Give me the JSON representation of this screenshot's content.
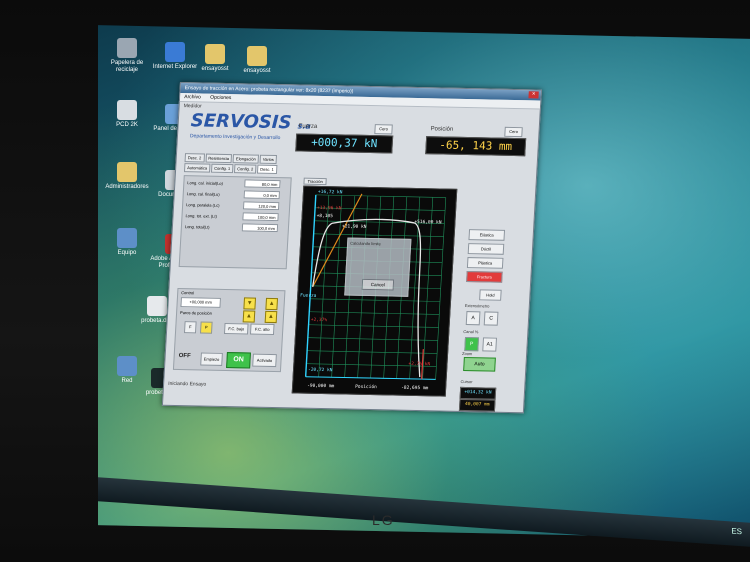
{
  "desktop": {
    "icons": [
      {
        "label": "Papelera de reciclaje",
        "icon": "recycle-bin-icon",
        "color": "#9aa6b2"
      },
      {
        "label": "Internet Explorer",
        "icon": "ie-icon",
        "color": "#3a7bd5"
      },
      {
        "label": "ensayosst",
        "icon": "folder-icon",
        "color": "#e3c66b"
      },
      {
        "label": "ensayosst",
        "icon": "folder-icon",
        "color": "#e3c66b"
      },
      {
        "label": "PCD 2K",
        "icon": "app-icon",
        "color": "#d8dde2"
      },
      {
        "label": "Panel de control",
        "icon": "control-panel-icon",
        "color": "#6aa0d8"
      },
      {
        "label": "Administradores",
        "icon": "folder-icon",
        "color": "#e3c66b"
      },
      {
        "label": "Documentos",
        "icon": "documents-icon",
        "color": "#cfd6dc"
      },
      {
        "label": "Equipo",
        "icon": "computer-icon",
        "color": "#5d8fc8"
      },
      {
        "label": "Adobe Acrobat 7.0 Professional",
        "icon": "acrobat-icon",
        "color": "#c0322e"
      },
      {
        "label": "probeta.doc",
        "icon": "document-icon",
        "color": "#e6e9ec"
      },
      {
        "label": "Red",
        "icon": "network-icon",
        "color": "#5d8fc8"
      },
      {
        "label": "probeta.dat",
        "icon": "terminal-icon",
        "color": "#1a2a2a"
      }
    ]
  },
  "window": {
    "title": "Ensayo de tracción en Acero: probeta rectangular ver: 8x20 (8237 (imperio))",
    "menu": [
      "Archivo",
      "Opciones"
    ],
    "medidor_label": "Medidor",
    "logo": {
      "main": "SERVOSIS",
      "suffix": "s.a",
      "subtitle": "Departamento Investigación y Desarrollo"
    },
    "fuerza": {
      "label": "Fuerza",
      "value": "+000,37 kN",
      "cero": "Cero"
    },
    "posicion": {
      "label": "Posición",
      "value": "-65, 143 mm",
      "cero": "Cero"
    },
    "tabs": [
      "Desc. 2",
      "Resistencia",
      "Elongación",
      "Varios",
      "Automática",
      "Config. 1",
      "Config. 2",
      "Desc. 1"
    ],
    "params": [
      {
        "label": "Long. cal. inicial(Lo)",
        "value": "80,0 mm"
      },
      {
        "label": "Long. cal. final(Lu)",
        "value": "0,0 mm"
      },
      {
        "label": "Long. paralela (Lc)",
        "value": "120,0 mm"
      },
      {
        "label": "Long. tot. ext. (Lt)",
        "value": "100,0 mm"
      },
      {
        "label": "Long. total(Lt)",
        "value": "100,0 mm"
      }
    ],
    "control": {
      "title": "Control",
      "velocidad": "+00,000 mm",
      "paros_label": "Paros de posición",
      "f_btn": "F",
      "p_btn": "P",
      "fc_bajo": "F.C. bajo",
      "fc_alto": "F.C. alto",
      "off_label": "OFF",
      "start_btn": "Empiezo",
      "on_label": "ON",
      "activate_btn": "Activado"
    },
    "status": "Iniciando Ensayo",
    "plot_tab": "Tracción",
    "plot": {
      "y_top": "+16,72 kN",
      "y_bottom": "-20,72 kN",
      "x_left": "-90,000 mm",
      "x_right": "-82,695 mm",
      "x_label": "Posición",
      "y_label": "Fuerza",
      "peak": "+13,96 kN",
      "cursor_a": "+8,105",
      "cursor_b": "+21,90 kN",
      "cursor_c": "+516,00 kN",
      "low_mark": "+2,37%",
      "red_bottom": "+2,75 kN",
      "dialog_title": "Calculando límite",
      "dialog_button": "Cancel"
    },
    "right_panel": {
      "modes": [
        "Elástica",
        "Dúctil",
        "Plástica",
        "Fractura"
      ],
      "hold": "Hold",
      "extensometro_label": "Extensómetro",
      "ext_a": "A",
      "ext_c": "C",
      "canal_label": "Canal %",
      "canal_p": "P",
      "canal_a1": "A1",
      "zoom_label": "Zoom",
      "zoom_auto": "Auto",
      "cursor_label": "Cursor",
      "cursor_force": "+014,32 kN",
      "cursor_pos": "40,007 mm"
    }
  },
  "taskbar": {
    "tray": "ES"
  },
  "brand": {
    "monitor": "LG"
  },
  "colors": {
    "accent_cyan": "#6fe3ff",
    "accent_yellow": "#ffd34a",
    "plot_grid": "#1f8f5a",
    "curve": "#e8e8e8",
    "elastic_line": "#e08a1c",
    "fracture_red": "#e23b3b"
  }
}
